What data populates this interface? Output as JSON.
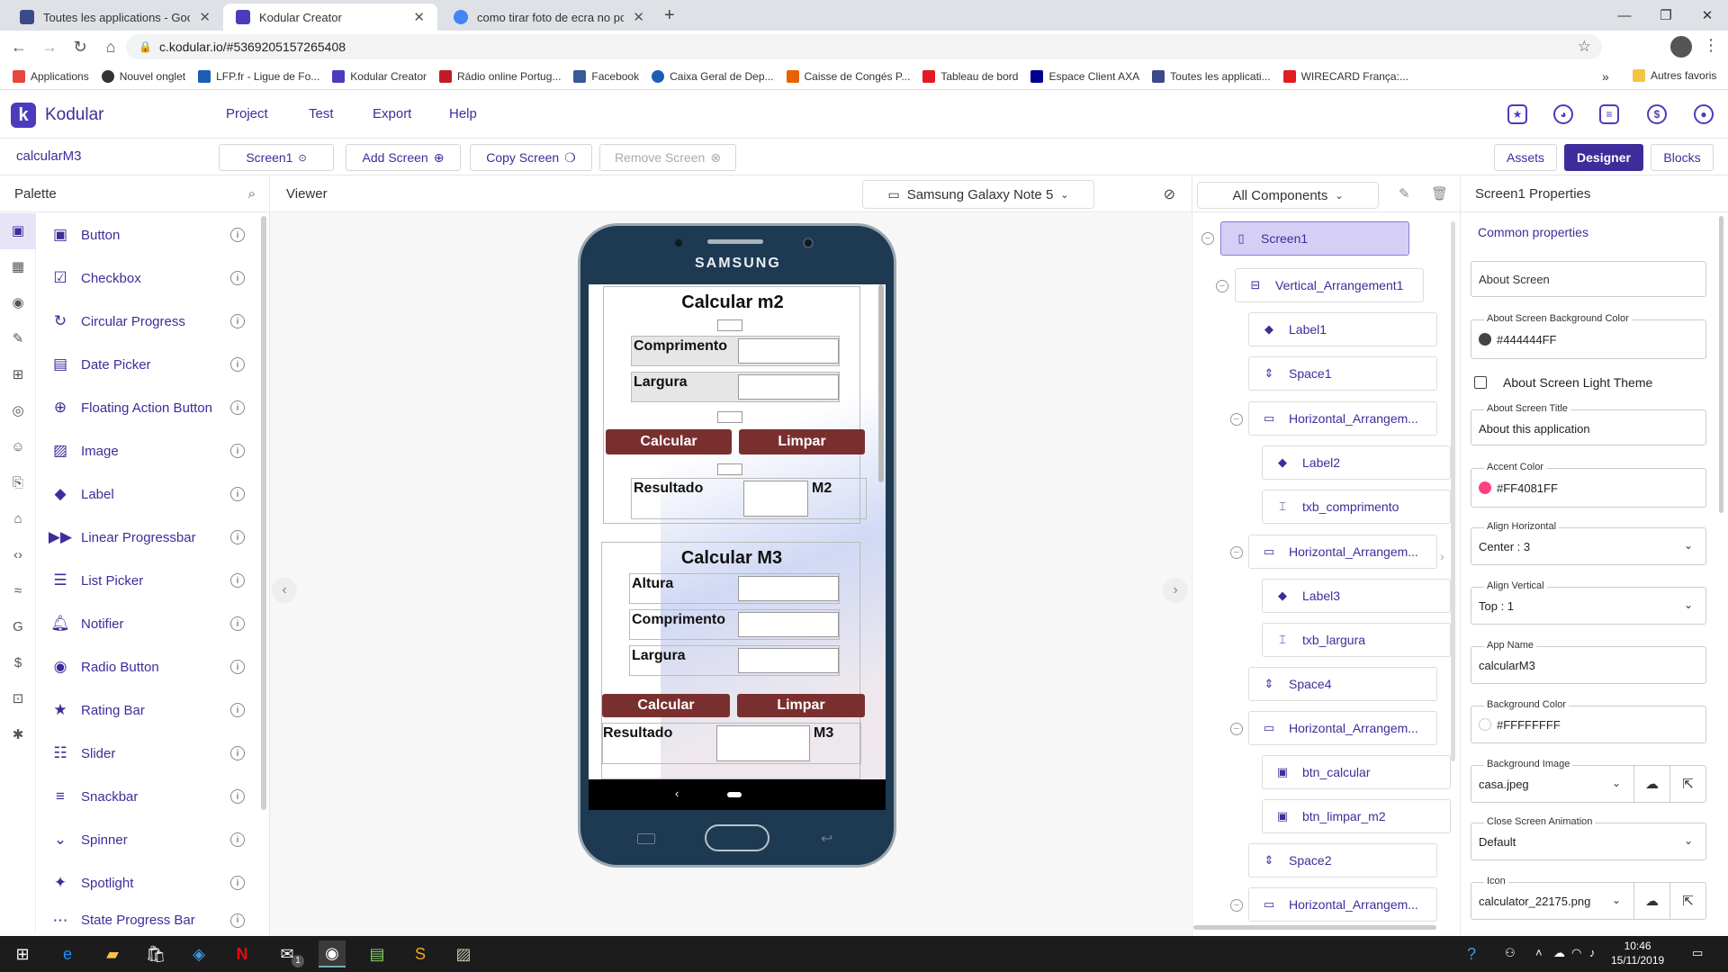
{
  "browser": {
    "tabs": [
      {
        "title": "Toutes les applications - Google",
        "color": "#3c4a8a"
      },
      {
        "title": "Kodular Creator",
        "color": "#4b3bbd"
      },
      {
        "title": "como tirar foto de ecra no pc - R",
        "color": "#4285f4"
      }
    ],
    "url": "c.kodular.io/#5369205157265408",
    "bookmarks": [
      {
        "label": "Applications",
        "color": "#e8453c"
      },
      {
        "label": "Nouvel onglet",
        "color": "#333333"
      },
      {
        "label": "LFP.fr - Ligue de Fo...",
        "color": "#1a5fb4"
      },
      {
        "label": "Kodular Creator",
        "color": "#4b3bbd"
      },
      {
        "label": "Rádio online Portug...",
        "color": "#c01c28"
      },
      {
        "label": "Facebook",
        "color": "#3b5998"
      },
      {
        "label": "Caixa Geral de Dep...",
        "color": "#1a5fb4"
      },
      {
        "label": "Caisse de Congés P...",
        "color": "#e66100"
      },
      {
        "label": "Tableau de bord",
        "color": "#e01b24"
      },
      {
        "label": "Espace Client AXA",
        "color": "#00008f"
      },
      {
        "label": "Toutes les applicati...",
        "color": "#3c4a8a"
      },
      {
        "label": "WIRECARD França:...",
        "color": "#e01b24"
      }
    ],
    "other_bookmarks": "Autres favoris",
    "more_bookmarks": "»"
  },
  "kodular": {
    "brand": "Kodular",
    "menu": [
      "Project",
      "Test",
      "Export",
      "Help"
    ],
    "project_name": "calcularM3",
    "screen_btn": "Screen1",
    "add_screen": "Add Screen",
    "copy_screen": "Copy Screen",
    "remove_screen": "Remove Screen",
    "assets": "Assets",
    "designer": "Designer",
    "blocks": "Blocks"
  },
  "palette": {
    "title": "Palette",
    "items": [
      {
        "label": "Button",
        "icon": "button-icon"
      },
      {
        "label": "Checkbox",
        "icon": "checkbox-icon"
      },
      {
        "label": "Circular Progress",
        "icon": "circular-progress-icon"
      },
      {
        "label": "Date Picker",
        "icon": "calendar-icon"
      },
      {
        "label": "Floating Action Button",
        "icon": "plus-circle-icon"
      },
      {
        "label": "Image",
        "icon": "image-icon"
      },
      {
        "label": "Label",
        "icon": "label-icon"
      },
      {
        "label": "Linear Progressbar",
        "icon": "fast-forward-icon"
      },
      {
        "label": "List Picker",
        "icon": "list-icon"
      },
      {
        "label": "Notifier",
        "icon": "bell-icon"
      },
      {
        "label": "Radio Button",
        "icon": "radio-icon"
      },
      {
        "label": "Rating Bar",
        "icon": "star-icon"
      },
      {
        "label": "Slider",
        "icon": "slider-icon"
      },
      {
        "label": "Snackbar",
        "icon": "snackbar-icon"
      },
      {
        "label": "Spinner",
        "icon": "spinner-icon"
      },
      {
        "label": "Spotlight",
        "icon": "spotlight-icon"
      },
      {
        "label": "State Progress Bar",
        "icon": "state-progress-icon"
      }
    ]
  },
  "viewer": {
    "title": "Viewer",
    "device": "Samsung Galaxy Note 5",
    "phone_brand": "SAMSUNG",
    "app": {
      "title_m2": "Calcular m2",
      "comprimento": "Comprimento",
      "largura": "Largura",
      "calcular": "Calcular",
      "limpar": "Limpar",
      "resultado": "Resultado",
      "unit_m2": "M2",
      "title_m3": "Calcular M3",
      "altura": "Altura",
      "unit_m3": "M3"
    }
  },
  "components": {
    "filter": "All Components",
    "tree": [
      {
        "label": "Screen1",
        "icon": "phone-icon"
      },
      {
        "label": "Vertical_Arrangement1",
        "icon": "vertical-arrangement-icon"
      },
      {
        "label": "Label1",
        "icon": "label-icon"
      },
      {
        "label": "Space1",
        "icon": "space-icon"
      },
      {
        "label": "Horizontal_Arrangem...",
        "icon": "horizontal-arrangement-icon"
      },
      {
        "label": "Label2",
        "icon": "label-icon"
      },
      {
        "label": "txb_comprimento",
        "icon": "textbox-icon"
      },
      {
        "label": "Horizontal_Arrangem...",
        "icon": "horizontal-arrangement-icon"
      },
      {
        "label": "Label3",
        "icon": "label-icon"
      },
      {
        "label": "txb_largura",
        "icon": "textbox-icon"
      },
      {
        "label": "Space4",
        "icon": "space-icon"
      },
      {
        "label": "Horizontal_Arrangem...",
        "icon": "horizontal-arrangement-icon"
      },
      {
        "label": "btn_calcular",
        "icon": "button-icon"
      },
      {
        "label": "btn_limpar_m2",
        "icon": "button-icon"
      },
      {
        "label": "Space2",
        "icon": "space-icon"
      },
      {
        "label": "Horizontal_Arrangem...",
        "icon": "horizontal-arrangement-icon"
      }
    ]
  },
  "properties": {
    "title": "Screen1 Properties",
    "section": "Common properties",
    "about_screen_placeholder": "About Screen",
    "bg_color_label": "About Screen Background Color",
    "bg_color_value": "#444444FF",
    "bg_color": "#444444",
    "light_theme": "About Screen Light Theme",
    "about_title_label": "About Screen Title",
    "about_title_value": "About this application",
    "accent_label": "Accent Color",
    "accent_value": "#FF4081FF",
    "accent_color": "#ff4081",
    "align_h_label": "Align Horizontal",
    "align_h_value": "Center : 3",
    "align_v_label": "Align Vertical",
    "align_v_value": "Top : 1",
    "app_name_label": "App Name",
    "app_name_value": "calcularM3",
    "background_label": "Background Color",
    "background_value": "#FFFFFFFF",
    "background_color": "#ffffff",
    "bg_image_label": "Background Image",
    "bg_image_value": "casa.jpeg",
    "close_anim_label": "Close Screen Animation",
    "close_anim_value": "Default",
    "icon_label": "Icon",
    "icon_value": "calculator_22175.png"
  },
  "taskbar": {
    "time": "10:46",
    "date": "15/11/2019",
    "mail_count": "1"
  }
}
